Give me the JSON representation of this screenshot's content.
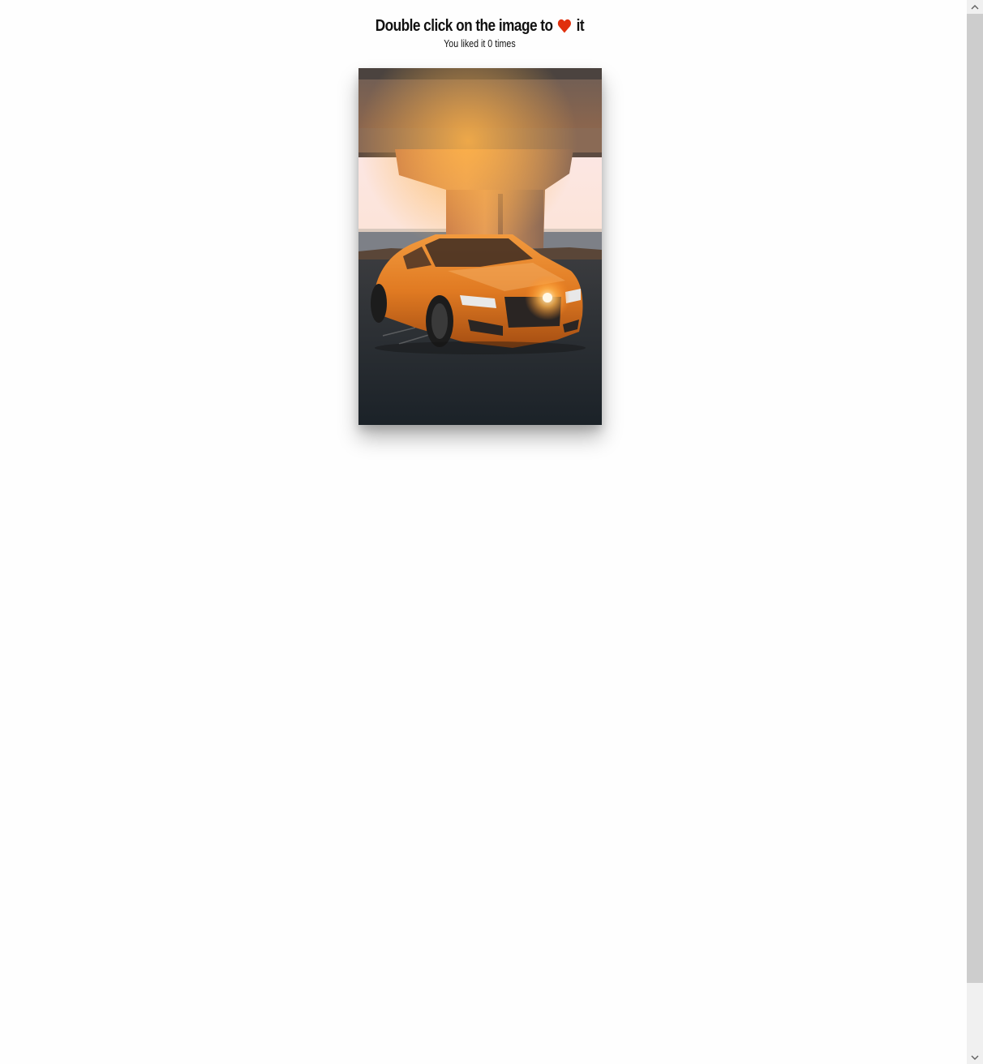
{
  "header": {
    "title_before": "Double click on the image to",
    "title_after": "it",
    "heart_icon": "heart-icon",
    "heart_color": "#e0300d",
    "like_text_prefix": "You liked it",
    "like_count": "0",
    "like_text_suffix": "times"
  },
  "photo": {
    "subject": "orange coupe parked under a concrete bridge at sunset"
  },
  "scrollbar": {
    "up_icon": "chevron-up-icon",
    "down_icon": "chevron-down-icon"
  }
}
